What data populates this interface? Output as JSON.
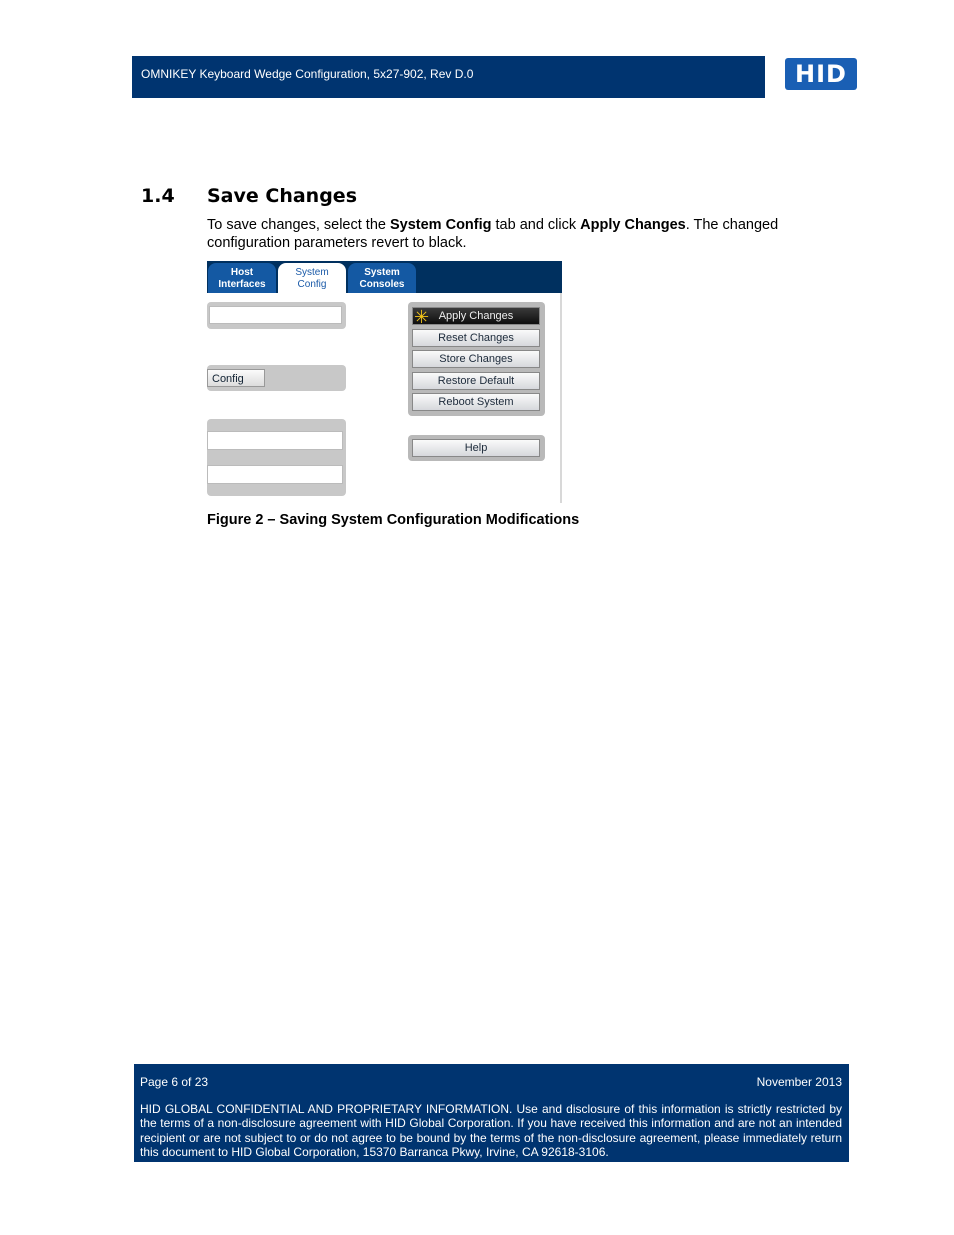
{
  "header": {
    "title": "OMNIKEY Keyboard Wedge Configuration, 5x27-902, Rev D.0",
    "logo_text": "HID",
    "brand_color": "#003470"
  },
  "section": {
    "number": "1.4",
    "title": "Save Changes",
    "para_parts": [
      "To save changes, select the ",
      "System Config",
      " tab and click ",
      "Apply Changes",
      ". The changed configuration parameters revert to black."
    ]
  },
  "figure": {
    "tabs": [
      {
        "line1": "Host",
        "line2": "Interfaces"
      },
      {
        "line1": "System",
        "line2": "Config",
        "active": true
      },
      {
        "line1": "System",
        "line2": "Consoles"
      }
    ],
    "config_button": "Config",
    "buttons": [
      "Apply Changes",
      "Reset Changes",
      "Store Changes",
      "Restore Default",
      "Reboot System"
    ],
    "help_button": "Help",
    "cursor_icon": "hand-pointer-icon",
    "caption": "Figure 2 – Saving System Configuration Modifications"
  },
  "footer": {
    "page": "Page 6 of 23",
    "date": "November 2013",
    "confidential": "HID GLOBAL CONFIDENTIAL AND PROPRIETARY INFORMATION.  Use and disclosure of this information is strictly restricted by the terms of a non-disclosure agreement with HID Global Corporation.  If you have received this information and are not an intended recipient or are not subject to or do not agree to be bound by the terms of the non-disclosure agreement, please immediately return this document to HID Global Corporation, 15370 Barranca Pkwy, Irvine, CA 92618-3106."
  }
}
